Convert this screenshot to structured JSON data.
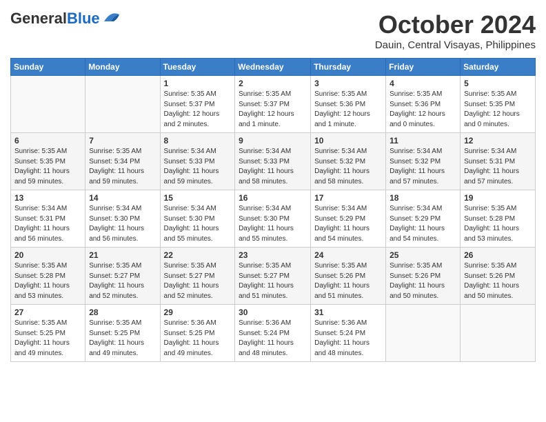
{
  "header": {
    "logo_line1": "General",
    "logo_line2": "Blue",
    "month": "October 2024",
    "location": "Dauin, Central Visayas, Philippines"
  },
  "days_of_week": [
    "Sunday",
    "Monday",
    "Tuesday",
    "Wednesday",
    "Thursday",
    "Friday",
    "Saturday"
  ],
  "weeks": [
    [
      {
        "day": "",
        "info": ""
      },
      {
        "day": "",
        "info": ""
      },
      {
        "day": "1",
        "info": "Sunrise: 5:35 AM\nSunset: 5:37 PM\nDaylight: 12 hours\nand 2 minutes."
      },
      {
        "day": "2",
        "info": "Sunrise: 5:35 AM\nSunset: 5:37 PM\nDaylight: 12 hours\nand 1 minute."
      },
      {
        "day": "3",
        "info": "Sunrise: 5:35 AM\nSunset: 5:36 PM\nDaylight: 12 hours\nand 1 minute."
      },
      {
        "day": "4",
        "info": "Sunrise: 5:35 AM\nSunset: 5:36 PM\nDaylight: 12 hours\nand 0 minutes."
      },
      {
        "day": "5",
        "info": "Sunrise: 5:35 AM\nSunset: 5:35 PM\nDaylight: 12 hours\nand 0 minutes."
      }
    ],
    [
      {
        "day": "6",
        "info": "Sunrise: 5:35 AM\nSunset: 5:35 PM\nDaylight: 11 hours\nand 59 minutes."
      },
      {
        "day": "7",
        "info": "Sunrise: 5:35 AM\nSunset: 5:34 PM\nDaylight: 11 hours\nand 59 minutes."
      },
      {
        "day": "8",
        "info": "Sunrise: 5:34 AM\nSunset: 5:33 PM\nDaylight: 11 hours\nand 59 minutes."
      },
      {
        "day": "9",
        "info": "Sunrise: 5:34 AM\nSunset: 5:33 PM\nDaylight: 11 hours\nand 58 minutes."
      },
      {
        "day": "10",
        "info": "Sunrise: 5:34 AM\nSunset: 5:32 PM\nDaylight: 11 hours\nand 58 minutes."
      },
      {
        "day": "11",
        "info": "Sunrise: 5:34 AM\nSunset: 5:32 PM\nDaylight: 11 hours\nand 57 minutes."
      },
      {
        "day": "12",
        "info": "Sunrise: 5:34 AM\nSunset: 5:31 PM\nDaylight: 11 hours\nand 57 minutes."
      }
    ],
    [
      {
        "day": "13",
        "info": "Sunrise: 5:34 AM\nSunset: 5:31 PM\nDaylight: 11 hours\nand 56 minutes."
      },
      {
        "day": "14",
        "info": "Sunrise: 5:34 AM\nSunset: 5:30 PM\nDaylight: 11 hours\nand 56 minutes."
      },
      {
        "day": "15",
        "info": "Sunrise: 5:34 AM\nSunset: 5:30 PM\nDaylight: 11 hours\nand 55 minutes."
      },
      {
        "day": "16",
        "info": "Sunrise: 5:34 AM\nSunset: 5:30 PM\nDaylight: 11 hours\nand 55 minutes."
      },
      {
        "day": "17",
        "info": "Sunrise: 5:34 AM\nSunset: 5:29 PM\nDaylight: 11 hours\nand 54 minutes."
      },
      {
        "day": "18",
        "info": "Sunrise: 5:34 AM\nSunset: 5:29 PM\nDaylight: 11 hours\nand 54 minutes."
      },
      {
        "day": "19",
        "info": "Sunrise: 5:35 AM\nSunset: 5:28 PM\nDaylight: 11 hours\nand 53 minutes."
      }
    ],
    [
      {
        "day": "20",
        "info": "Sunrise: 5:35 AM\nSunset: 5:28 PM\nDaylight: 11 hours\nand 53 minutes."
      },
      {
        "day": "21",
        "info": "Sunrise: 5:35 AM\nSunset: 5:27 PM\nDaylight: 11 hours\nand 52 minutes."
      },
      {
        "day": "22",
        "info": "Sunrise: 5:35 AM\nSunset: 5:27 PM\nDaylight: 11 hours\nand 52 minutes."
      },
      {
        "day": "23",
        "info": "Sunrise: 5:35 AM\nSunset: 5:27 PM\nDaylight: 11 hours\nand 51 minutes."
      },
      {
        "day": "24",
        "info": "Sunrise: 5:35 AM\nSunset: 5:26 PM\nDaylight: 11 hours\nand 51 minutes."
      },
      {
        "day": "25",
        "info": "Sunrise: 5:35 AM\nSunset: 5:26 PM\nDaylight: 11 hours\nand 50 minutes."
      },
      {
        "day": "26",
        "info": "Sunrise: 5:35 AM\nSunset: 5:26 PM\nDaylight: 11 hours\nand 50 minutes."
      }
    ],
    [
      {
        "day": "27",
        "info": "Sunrise: 5:35 AM\nSunset: 5:25 PM\nDaylight: 11 hours\nand 49 minutes."
      },
      {
        "day": "28",
        "info": "Sunrise: 5:35 AM\nSunset: 5:25 PM\nDaylight: 11 hours\nand 49 minutes."
      },
      {
        "day": "29",
        "info": "Sunrise: 5:36 AM\nSunset: 5:25 PM\nDaylight: 11 hours\nand 49 minutes."
      },
      {
        "day": "30",
        "info": "Sunrise: 5:36 AM\nSunset: 5:24 PM\nDaylight: 11 hours\nand 48 minutes."
      },
      {
        "day": "31",
        "info": "Sunrise: 5:36 AM\nSunset: 5:24 PM\nDaylight: 11 hours\nand 48 minutes."
      },
      {
        "day": "",
        "info": ""
      },
      {
        "day": "",
        "info": ""
      }
    ]
  ]
}
